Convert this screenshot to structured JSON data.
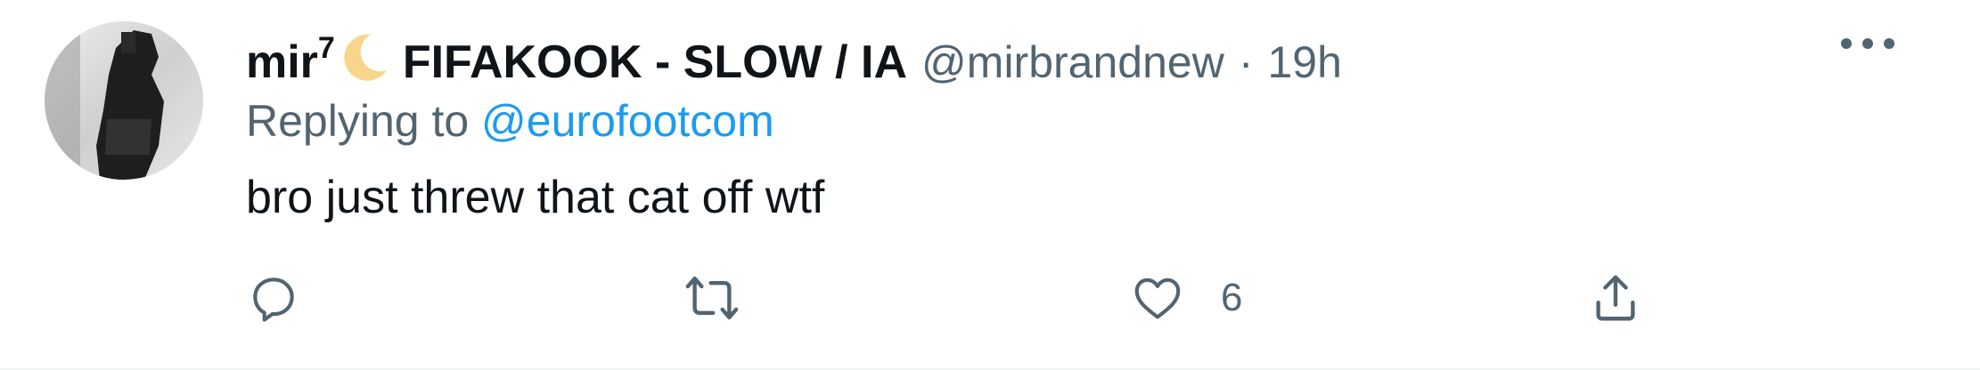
{
  "tweet": {
    "display_name_text": "mir",
    "display_name_superscript": "7",
    "display_name_emoji": "crescent-moon-icon",
    "display_name_rest": "FIFAKOOK - SLOW / IA",
    "handle": "@mirbrandnew",
    "separator": "·",
    "time": "19h",
    "replying_prefix": "Replying to ",
    "replying_to": "@eurofootcom",
    "text": "bro just threw that cat off wtf"
  },
  "actions": {
    "reply_icon": "reply-icon",
    "retweet_icon": "retweet-icon",
    "like_icon": "heart-icon",
    "like_count": "6",
    "share_icon": "share-icon"
  },
  "colors": {
    "text_primary": "#0f1419",
    "text_secondary": "#536471",
    "link": "#1d9bf0",
    "background": "#ffffff",
    "moon": "#f7d58a"
  }
}
